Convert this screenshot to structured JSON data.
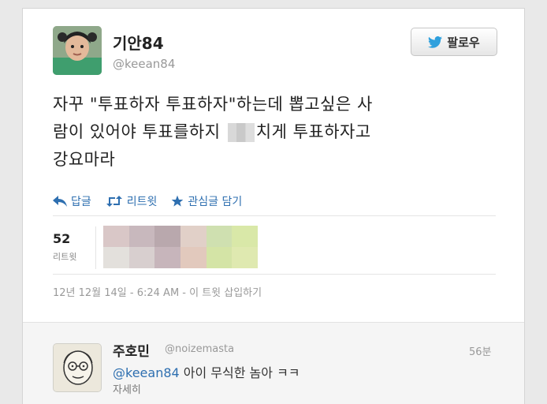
{
  "tweet": {
    "author_name": "기안84",
    "author_handle": "@keean84",
    "follow_label": "팔로우",
    "text_line1": "자꾸 \"투표하자 투표하자\"하는데 뽑고싶은 사",
    "text_line2_before": "람이 있어야 투표를하지",
    "text_line2_after": "치게 투표하자고",
    "text_line3": "강요마라",
    "actions": {
      "reply": "답글",
      "retweet": "리트윗",
      "favorite": "관심글 담기"
    },
    "retweet_count": "52",
    "retweet_label": "리트윗",
    "retweeter_colors": [
      "#d9c7c7",
      "#c8b8bd",
      "#b9a8ad",
      "#e1d0c8",
      "#cfe0b0",
      "#d9e8a8",
      "#e3e0dc",
      "#d8cfcf",
      "#c7b5bb",
      "#e2c9bd",
      "#d4e4a6",
      "#dfe9b0"
    ],
    "timestamp": "12년 12월 14일 - 6:24 AM - 이 트윗 삽입하기"
  },
  "reply": {
    "author_name": "주호민",
    "author_handle": "@noizemasta",
    "time": "56분",
    "mention": "@keean84",
    "text": " 아이 무식한 놈아 ㅋㅋ",
    "detail_label": "자세히"
  },
  "colors": {
    "link": "#2e6fb0",
    "twitter_blue": "#2fa0dd"
  }
}
